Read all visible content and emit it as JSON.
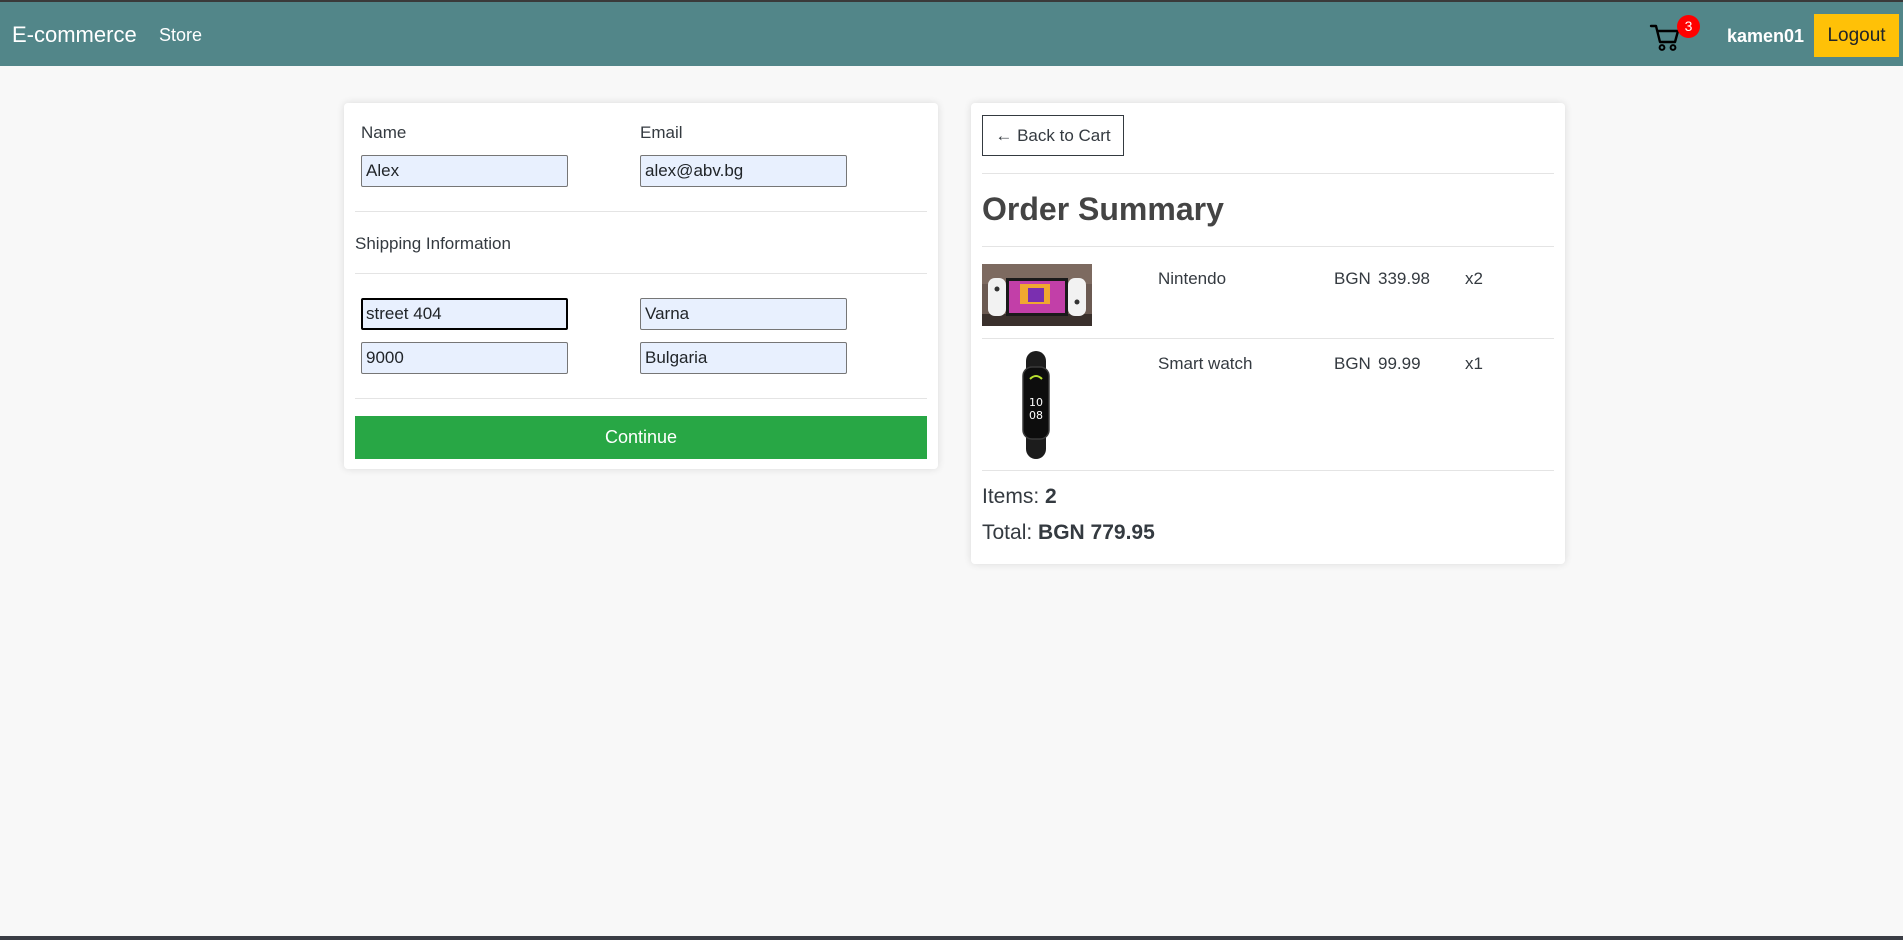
{
  "navbar": {
    "brand": "E-commerce",
    "store_link": "Store",
    "cart_icon": "shopping-cart-icon",
    "cart_count": "3",
    "username": "kamen01",
    "logout_label": "Logout"
  },
  "form": {
    "name_label": "Name",
    "name_value": "Alex",
    "email_label": "Email",
    "email_value": "alex@abv.bg",
    "shipping_title": "Shipping Information",
    "address_value": "street 404",
    "city_value": "Varna",
    "zip_value": "9000",
    "country_value": "Bulgaria",
    "continue_label": "Continue"
  },
  "summary": {
    "back_label": "← Back to Cart",
    "title": "Order Summary",
    "items": [
      {
        "name": "Nintendo",
        "currency": "BGN",
        "price": "339.98",
        "qty": "x2",
        "image": "nintendo-switch-image"
      },
      {
        "name": "Smart watch",
        "currency": "BGN",
        "price": "99.99",
        "qty": "x1",
        "image": "smart-watch-image"
      }
    ],
    "items_label": "Items:",
    "items_count": "2",
    "total_label": "Total:",
    "total_value": "BGN 779.95"
  },
  "colors": {
    "navbar": "#528689",
    "logout": "#ffc107",
    "continue": "#28a745",
    "badge": "#ff0000"
  }
}
